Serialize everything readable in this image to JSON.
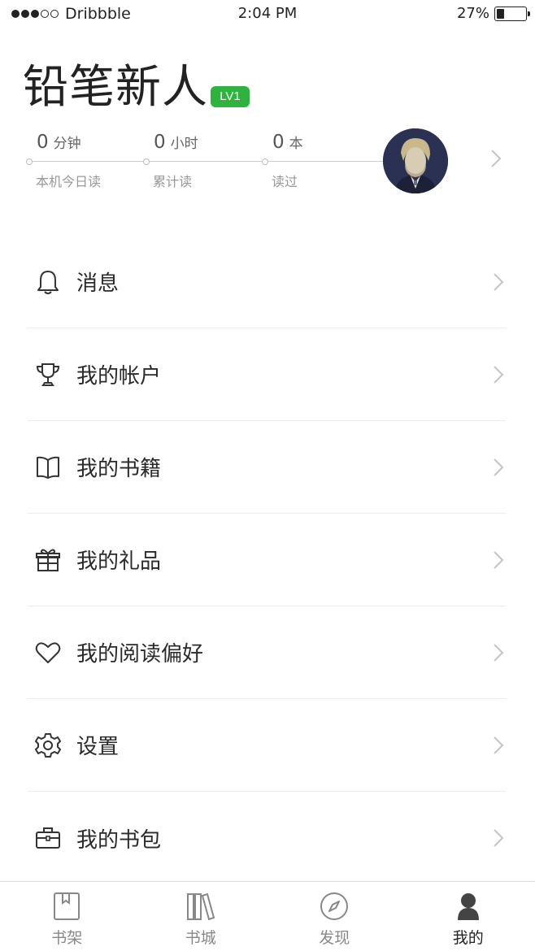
{
  "status_bar": {
    "carrier": "Dribbble",
    "time": "2:04 PM",
    "battery": "27%",
    "battery_level": 0.27
  },
  "profile": {
    "username": "铅笔新人",
    "level": "LV1",
    "level_color": "#2fb33f",
    "stats": [
      {
        "value": "0",
        "unit": "分钟",
        "label": "本机今日读"
      },
      {
        "value": "0",
        "unit": "小时",
        "label": "累计读"
      },
      {
        "value": "0",
        "unit": "本",
        "label": "读过"
      }
    ],
    "avatar_icon": "user-portrait",
    "chevron_icon": "chevron-right-icon"
  },
  "menu": {
    "items": [
      {
        "label": "消息",
        "icon": "bell-icon"
      },
      {
        "label": "我的帐户",
        "icon": "trophy-icon"
      },
      {
        "label": "我的书籍",
        "icon": "book-open-icon"
      },
      {
        "label": "我的礼品",
        "icon": "gift-icon"
      },
      {
        "label": "我的阅读偏好",
        "icon": "heart-icon"
      },
      {
        "label": "设置",
        "icon": "gear-icon"
      },
      {
        "label": "我的书包",
        "icon": "briefcase-icon"
      }
    ]
  },
  "tab_bar": {
    "tabs": [
      {
        "label": "书架",
        "icon": "bookshelf-icon",
        "active": false
      },
      {
        "label": "书城",
        "icon": "library-icon",
        "active": false
      },
      {
        "label": "发现",
        "icon": "compass-icon",
        "active": false
      },
      {
        "label": "我的",
        "icon": "person-icon",
        "active": true
      }
    ]
  }
}
